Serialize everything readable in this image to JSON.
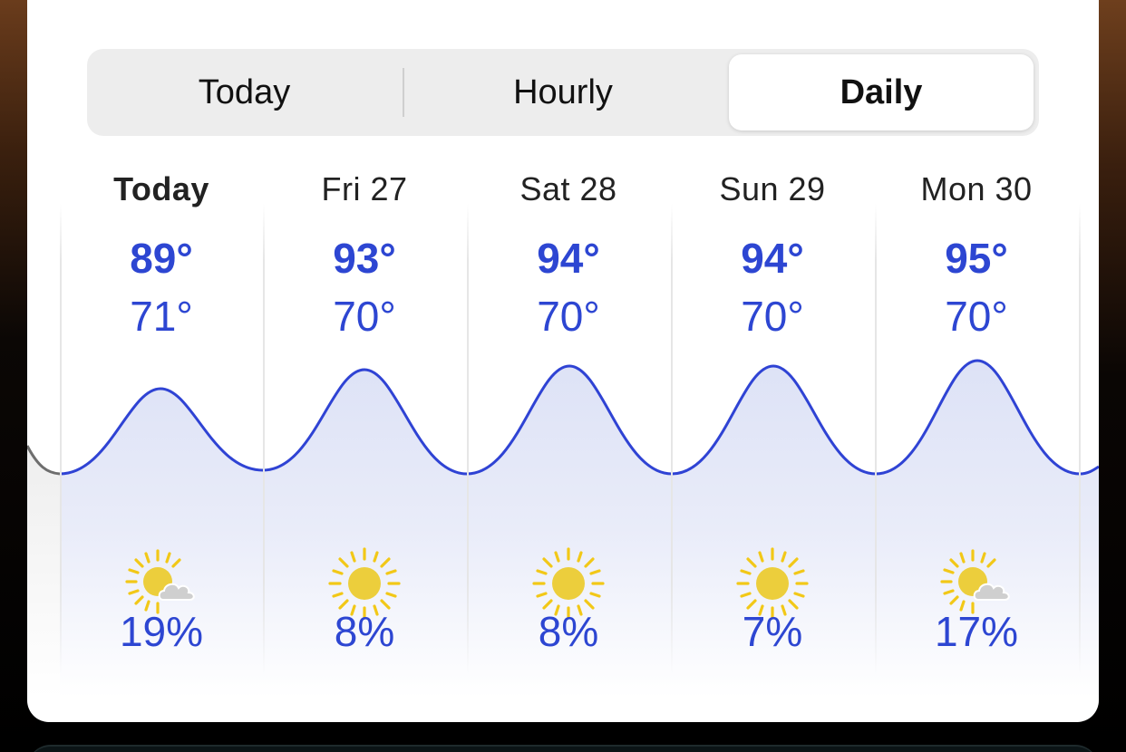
{
  "tabs": [
    {
      "label": "Today",
      "selected": false
    },
    {
      "label": "Hourly",
      "selected": false
    },
    {
      "label": "Daily",
      "selected": true
    }
  ],
  "days": [
    {
      "label": "Today",
      "high": "89°",
      "low": "71°",
      "precip": "19%",
      "icon": "partly-sunny-icon",
      "emphasis": true
    },
    {
      "label": "Fri 27",
      "high": "93°",
      "low": "70°",
      "precip": "8%",
      "icon": "sun-icon",
      "emphasis": false
    },
    {
      "label": "Sat 28",
      "high": "94°",
      "low": "70°",
      "precip": "8%",
      "icon": "sun-icon",
      "emphasis": false
    },
    {
      "label": "Sun 29",
      "high": "94°",
      "low": "70°",
      "precip": "7%",
      "icon": "sun-icon",
      "emphasis": false
    },
    {
      "label": "Mon 30",
      "high": "95°",
      "low": "70°",
      "precip": "17%",
      "icon": "partly-sunny-icon",
      "emphasis": false
    }
  ],
  "colors": {
    "temperature_text": "#2d46d2",
    "curve": "#2f43d4",
    "curve_fill": "#dfe3f7",
    "sun": "#f2c817",
    "sun_core": "#ecce3c",
    "cloud": "#c9c9c9",
    "selected_tab": "#ffffff",
    "segmented_bg": "#ededed"
  }
}
